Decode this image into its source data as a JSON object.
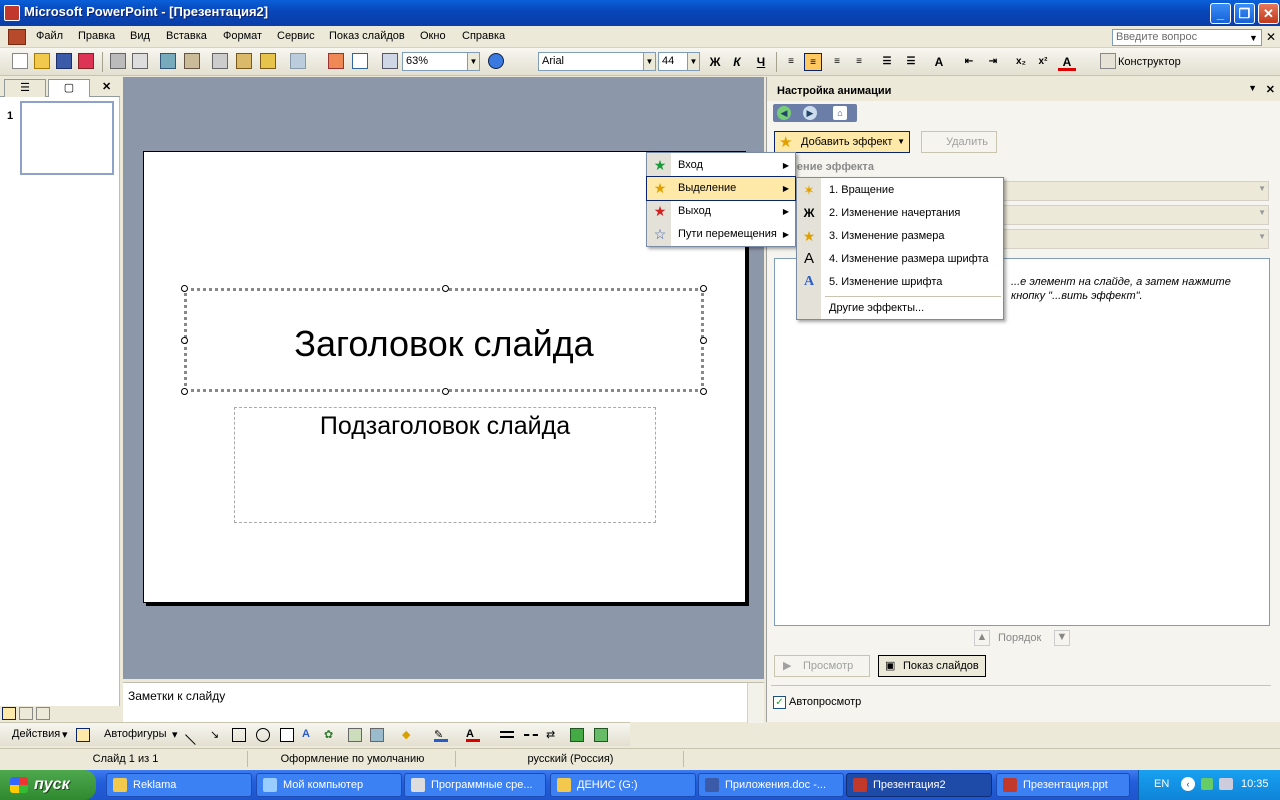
{
  "window": {
    "title": "Microsoft PowerPoint - [Презентация2]",
    "minimize": "_",
    "maximize": "❐",
    "close": "✕"
  },
  "menubar": {
    "items": [
      "Файл",
      "Правка",
      "Вид",
      "Вставка",
      "Формат",
      "Сервис",
      "Показ слайдов",
      "Окно",
      "Справка"
    ],
    "help_placeholder": "Введите вопрос",
    "doc_close": "✕"
  },
  "toolbar": {
    "zoom": "63%",
    "font": "Arial",
    "font_size": "44",
    "bold": "Ж",
    "italic": "К",
    "underline": "Ч",
    "design_label": "Конструктор"
  },
  "left_pane": {
    "slide_number": "1"
  },
  "slide": {
    "title": "Заголовок слайда",
    "subtitle": "Подзаголовок слайда"
  },
  "notes": {
    "placeholder": "Заметки к слайду"
  },
  "taskpane": {
    "title": "Настройка анимации",
    "add_effect": "Добавить эффект",
    "remove": "Удалить",
    "change_label": "...енение эффекта",
    "hint": "...е элемент на слайде, а затем нажмите кнопку \"...вить эффект\".",
    "order": "Порядок",
    "preview": "Просмотр",
    "slideshow": "Показ слайдов",
    "autopreview": "Автопросмотр"
  },
  "effect_menu": {
    "items": [
      {
        "label": "Вход",
        "icon": "green-star-icon"
      },
      {
        "label": "Выделение",
        "icon": "yellow-star-icon"
      },
      {
        "label": "Выход",
        "icon": "red-star-icon"
      },
      {
        "label": "Пути перемещения",
        "icon": "outline-star-icon"
      }
    ]
  },
  "emphasis_submenu": {
    "items": [
      {
        "label": "1. Вращение",
        "icon": "spin-star-icon"
      },
      {
        "label": "2. Изменение начертания",
        "icon": "bold-zh-icon"
      },
      {
        "label": "3. Изменение размера",
        "icon": "grow-star-icon"
      },
      {
        "label": "4. Изменение размера шрифта",
        "icon": "font-size-icon"
      },
      {
        "label": "5. Изменение шрифта",
        "icon": "font-change-icon"
      }
    ],
    "more": "Другие эффекты..."
  },
  "drawbar": {
    "actions": "Действия",
    "autoshapes": "Автофигуры"
  },
  "statusbar": {
    "slide_info": "Слайд 1 из 1",
    "design": "Оформление по умолчанию",
    "language": "русский (Россия)"
  },
  "taskbar": {
    "start": "пуск",
    "tasks": [
      {
        "label": "Reklama"
      },
      {
        "label": "Мой компьютер"
      },
      {
        "label": "Программные сре..."
      },
      {
        "label": "ДЕНИС (G:)"
      },
      {
        "label": "Приложения.doc -..."
      },
      {
        "label": "Презентация2"
      },
      {
        "label": "Презентация.ppt"
      }
    ],
    "lang": "EN",
    "clock": "10:35"
  },
  "colors": {
    "titlebar": "#0a5fd8",
    "highlight": "#ffe9a8",
    "slide_bg": "#8d97aa"
  }
}
